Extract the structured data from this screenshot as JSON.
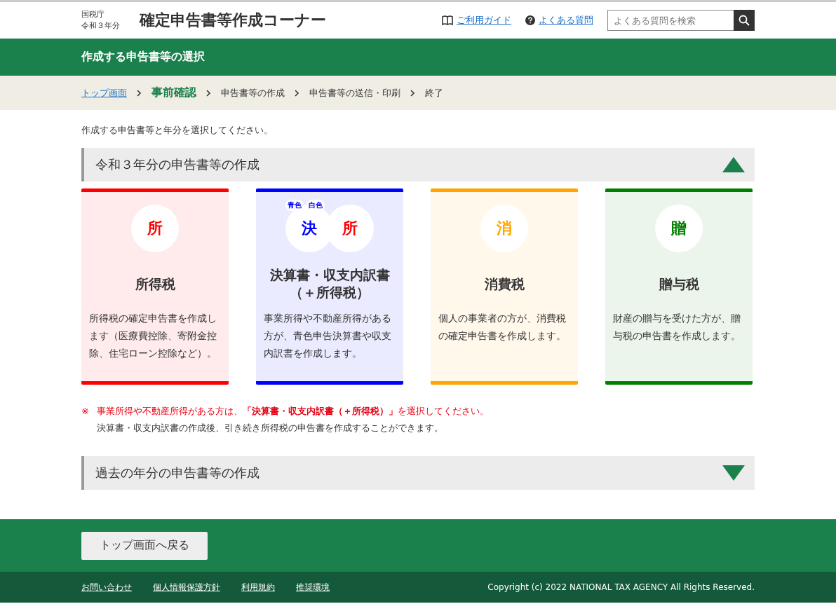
{
  "header": {
    "agency": "国税庁",
    "year": "令和３年分",
    "title": "確定申告書等作成コーナー",
    "links": [
      {
        "kind": "guide",
        "label": "ご利用ガイド"
      },
      {
        "kind": "faq",
        "label": "よくある質問"
      }
    ],
    "search": {
      "placeholder": "よくある質問を検索"
    }
  },
  "page_title": "作成する申告書等の選択",
  "breadcrumb": [
    {
      "kind": "link",
      "label": "トップ画面"
    },
    {
      "kind": "current",
      "label": "事前確認"
    },
    {
      "kind": "plain",
      "label": "申告書等の作成"
    },
    {
      "kind": "plain",
      "label": "申告書等の送信・印刷"
    },
    {
      "kind": "plain",
      "label": "終了"
    }
  ],
  "intro": "作成する申告書等と年分を選択してください。",
  "sections": [
    {
      "title": "令和３年分の申告書等の作成",
      "expanded": true
    },
    {
      "title": "過去の年分の申告書等の作成",
      "expanded": false
    }
  ],
  "cards": [
    {
      "color": "#ff0000",
      "title": "所得税",
      "icons": [
        {
          "glyph": "所",
          "color": "#ff0000"
        }
      ],
      "description": "所得税の確定申告書を作成します（医療費控除、寄附金控除、住宅ローン控除など）。"
    },
    {
      "color": "#0000ff",
      "title": "決算書・収支内訳書（＋所得税）",
      "icons": [
        {
          "glyph": "決",
          "color": "#0000ff"
        },
        {
          "glyph": "所",
          "color": "#ff0000"
        }
      ],
      "badges": [
        "青色",
        "白色"
      ],
      "description": "事業所得や不動産所得がある方が、青色申告決算書や収支内訳書を作成します。"
    },
    {
      "color": "#ffa500",
      "title": "消費税",
      "icons": [
        {
          "glyph": "消",
          "color": "#ffa500"
        }
      ],
      "description": "個人の事業者の方が、消費税の確定申告書を作成します。"
    },
    {
      "color": "#008000",
      "title": "贈与税",
      "icons": [
        {
          "glyph": "贈",
          "color": "#008000"
        }
      ],
      "description": "財産の贈与を受けた方が、贈与税の申告書を作成します。"
    }
  ],
  "note": {
    "mark": "※",
    "lines": [
      "事業所得や不動産所得がある方は、**「決算書・収支内訳書（＋所得税）」**を選択してください。",
      "決算書・収支内訳書の作成後、引き続き所得税の申告書を作成することができます。"
    ]
  },
  "back_button": "トップ画面へ戻る",
  "footer": {
    "links": [
      "お問い合わせ",
      "個人情報保護方針",
      "利用規約",
      "推奨環境"
    ],
    "copyright": "Copyright (c) 2022 NATIONAL TAX AGENCY All Rights Reserved."
  }
}
